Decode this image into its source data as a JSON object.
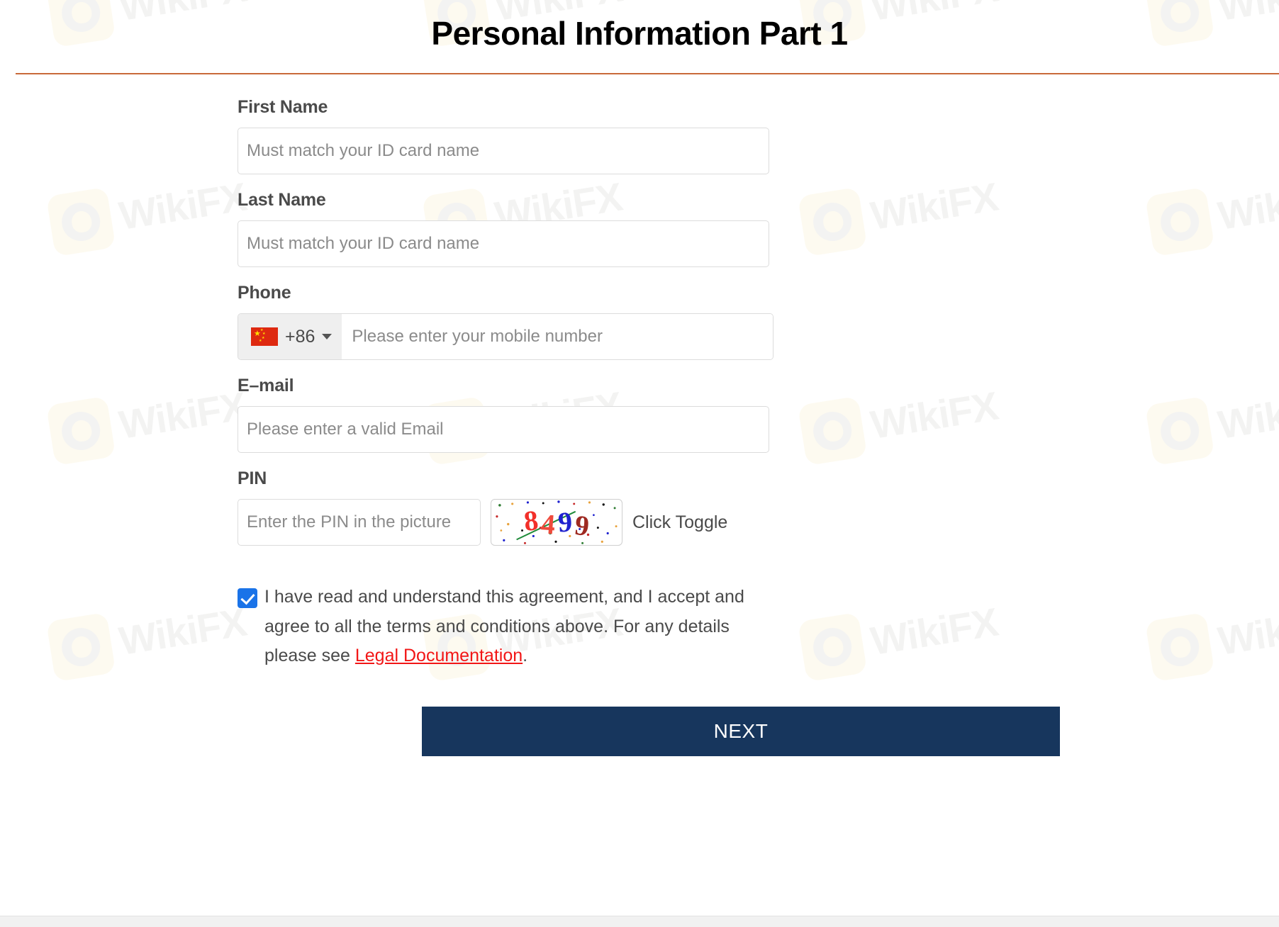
{
  "page": {
    "title": "Personal Information Part 1",
    "accent_rule_color": "#c96a3a"
  },
  "form": {
    "first_name": {
      "label": "First Name",
      "placeholder": "Must match your ID card name",
      "value": ""
    },
    "last_name": {
      "label": "Last Name",
      "placeholder": "Must match your ID card name",
      "value": ""
    },
    "phone": {
      "label": "Phone",
      "country_flag": "flag-china-icon",
      "dial_code": "+86",
      "placeholder": "Please enter your mobile number",
      "value": ""
    },
    "email": {
      "label": "E–mail",
      "placeholder": "Please enter a valid Email",
      "value": ""
    },
    "pin": {
      "label": "PIN",
      "placeholder": "Enter the PIN in the picture",
      "value": "",
      "captcha_text": "8499",
      "captcha_digits": [
        {
          "char": "8",
          "color": "#f2302a"
        },
        {
          "char": "4",
          "color": "#ef4a3c"
        },
        {
          "char": "9",
          "color": "#1f22cf"
        },
        {
          "char": "9",
          "color": "#9e2a22"
        }
      ],
      "toggle_label": "Click Toggle"
    }
  },
  "agreement": {
    "checked": true,
    "text_before": "I have read and understand this agreement, and I accept and agree to all the terms and conditions above. For any details please see ",
    "link_text": "Legal Documentation",
    "text_after": ".",
    "link_color": "#f21616",
    "checkbox_color": "#1a73e8"
  },
  "actions": {
    "next_label": "NEXT",
    "next_color": "#17365d"
  },
  "watermark": {
    "text": "WikiFX"
  }
}
